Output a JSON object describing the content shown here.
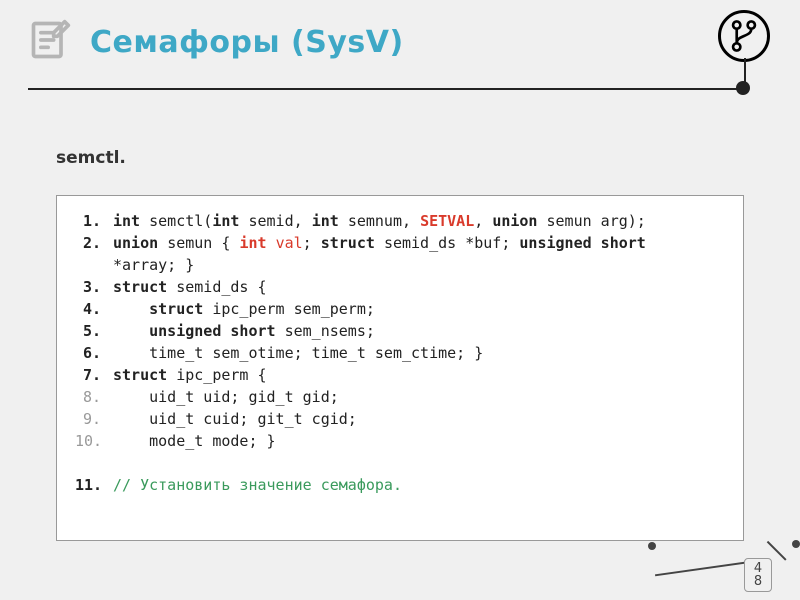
{
  "header": {
    "title": "Семафоры (SysV)",
    "subtitle": "semctl."
  },
  "code": {
    "lines": [
      {
        "n": "1.",
        "nstyle": "bold",
        "tokens": [
          {
            "t": "int ",
            "c": "kw"
          },
          {
            "t": "semctl("
          },
          {
            "t": "int ",
            "c": "kw"
          },
          {
            "t": "semid, "
          },
          {
            "t": "int ",
            "c": "kw"
          },
          {
            "t": "semnum, "
          },
          {
            "t": "SETVAL",
            "c": "special"
          },
          {
            "t": ", "
          },
          {
            "t": "union ",
            "c": "kw"
          },
          {
            "t": "semun arg);"
          }
        ]
      },
      {
        "n": "2.",
        "nstyle": "bold",
        "tokens": [
          {
            "t": "union ",
            "c": "kw"
          },
          {
            "t": "semun { "
          },
          {
            "t": "int ",
            "c": "special"
          },
          {
            "t": "val",
            "c": "special2"
          },
          {
            "t": "; "
          },
          {
            "t": "struct ",
            "c": "kw"
          },
          {
            "t": "semid_ds *buf; "
          },
          {
            "t": "unsigned short",
            "c": "kw"
          }
        ]
      },
      {
        "n": "",
        "nstyle": "",
        "tokens": [
          {
            "t": "*array; }"
          }
        ]
      },
      {
        "n": "3.",
        "nstyle": "bold",
        "tokens": [
          {
            "t": "struct ",
            "c": "kw"
          },
          {
            "t": "semid_ds {"
          }
        ]
      },
      {
        "n": "4.",
        "nstyle": "bold",
        "tokens": [
          {
            "t": "    "
          },
          {
            "t": "struct ",
            "c": "kw"
          },
          {
            "t": "ipc_perm sem_perm;"
          }
        ]
      },
      {
        "n": "5.",
        "nstyle": "bold",
        "tokens": [
          {
            "t": "    "
          },
          {
            "t": "unsigned short ",
            "c": "kw"
          },
          {
            "t": "sem_nsems;"
          }
        ]
      },
      {
        "n": "6.",
        "nstyle": "bold",
        "tokens": [
          {
            "t": "    time_t sem_otime; time_t sem_ctime; }"
          }
        ]
      },
      {
        "n": "7.",
        "nstyle": "bold",
        "tokens": [
          {
            "t": "struct ",
            "c": "kw"
          },
          {
            "t": "ipc_perm {"
          }
        ]
      },
      {
        "n": "8.",
        "nstyle": "dim",
        "tokens": [
          {
            "t": "    uid_t uid; gid_t gid;"
          }
        ]
      },
      {
        "n": "9.",
        "nstyle": "dim",
        "tokens": [
          {
            "t": "    uid_t cuid; git_t cgid;"
          }
        ]
      },
      {
        "n": "10.",
        "nstyle": "dim",
        "tokens": [
          {
            "t": "    mode_t mode; }"
          }
        ]
      },
      {
        "gap": true
      },
      {
        "n": "11.",
        "nstyle": "bold",
        "tokens": [
          {
            "t": "// Установить значение семафора.",
            "c": "comment"
          }
        ]
      }
    ]
  },
  "page": {
    "a": "4",
    "b": "8"
  }
}
